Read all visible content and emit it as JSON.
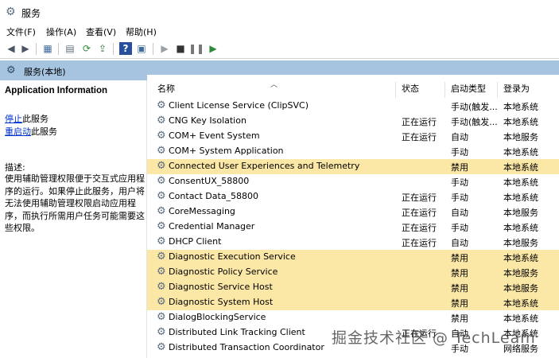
{
  "window": {
    "title": "服务"
  },
  "menu": [
    "文件(F)",
    "操作(A)",
    "查看(V)",
    "帮助(H)"
  ],
  "toolbar_icons": [
    "back-arrow-icon",
    "forward-arrow-icon",
    "console-tree-icon",
    "properties-icon",
    "refresh-icon",
    "export-list-icon",
    "help-icon",
    "show-hide-icon",
    "play-icon",
    "stop-icon",
    "pause-icon",
    "restart-icon"
  ],
  "header": {
    "label": "服务(本地)"
  },
  "left_panel": {
    "title": "Application Information",
    "stop_link": "停止",
    "stop_suffix": "此服务",
    "restart_link": "重启动",
    "restart_suffix": "此服务",
    "desc_label": "描述:",
    "description": "使用辅助管理权限便于交互式应用程序的运行。如果停止此服务，用户将无法使用辅助管理权限启动应用程序，而执行所需用户任务可能需要这些权限。"
  },
  "columns": {
    "name": "名称",
    "status": "状态",
    "startup": "启动类型",
    "logon": "登录为"
  },
  "rows": [
    {
      "name": "Client License Service (ClipSVC)",
      "status": "",
      "startup": "手动(触发...",
      "logon": "本地系统",
      "highlight": false
    },
    {
      "name": "CNG Key Isolation",
      "status": "正在运行",
      "startup": "手动(触发...",
      "logon": "本地系统",
      "highlight": false
    },
    {
      "name": "COM+ Event System",
      "status": "正在运行",
      "startup": "自动",
      "logon": "本地服务",
      "highlight": false
    },
    {
      "name": "COM+ System Application",
      "status": "",
      "startup": "手动",
      "logon": "本地系统",
      "highlight": false
    },
    {
      "name": "Connected User Experiences and Telemetry",
      "status": "",
      "startup": "禁用",
      "logon": "本地系统",
      "highlight": true
    },
    {
      "name": "ConsentUX_58800",
      "status": "",
      "startup": "手动",
      "logon": "本地系统",
      "highlight": false
    },
    {
      "name": "Contact Data_58800",
      "status": "正在运行",
      "startup": "手动",
      "logon": "本地系统",
      "highlight": false
    },
    {
      "name": "CoreMessaging",
      "status": "正在运行",
      "startup": "自动",
      "logon": "本地服务",
      "highlight": false
    },
    {
      "name": "Credential Manager",
      "status": "正在运行",
      "startup": "手动",
      "logon": "本地系统",
      "highlight": false
    },
    {
      "name": "DHCP Client",
      "status": "正在运行",
      "startup": "自动",
      "logon": "本地服务",
      "highlight": false
    },
    {
      "name": "Diagnostic Execution Service",
      "status": "",
      "startup": "禁用",
      "logon": "本地系统",
      "highlight": true
    },
    {
      "name": "Diagnostic Policy Service",
      "status": "",
      "startup": "禁用",
      "logon": "本地服务",
      "highlight": true
    },
    {
      "name": "Diagnostic Service Host",
      "status": "",
      "startup": "禁用",
      "logon": "本地服务",
      "highlight": true
    },
    {
      "name": "Diagnostic System Host",
      "status": "",
      "startup": "禁用",
      "logon": "本地系统",
      "highlight": true
    },
    {
      "name": "DialogBlockingService",
      "status": "",
      "startup": "禁用",
      "logon": "本地系统",
      "highlight": false
    },
    {
      "name": "Distributed Link Tracking Client",
      "status": "正在运行",
      "startup": "自动",
      "logon": "本地系统",
      "highlight": false
    },
    {
      "name": "Distributed Transaction Coordinator",
      "status": "",
      "startup": "手动",
      "logon": "网络服务",
      "highlight": false
    }
  ],
  "watermark": "掘金技术社区 @ TechLeam",
  "colors": {
    "header_band": "#a6c4e0",
    "highlight_row": "#fbe7a6",
    "link": "#0033cc"
  }
}
